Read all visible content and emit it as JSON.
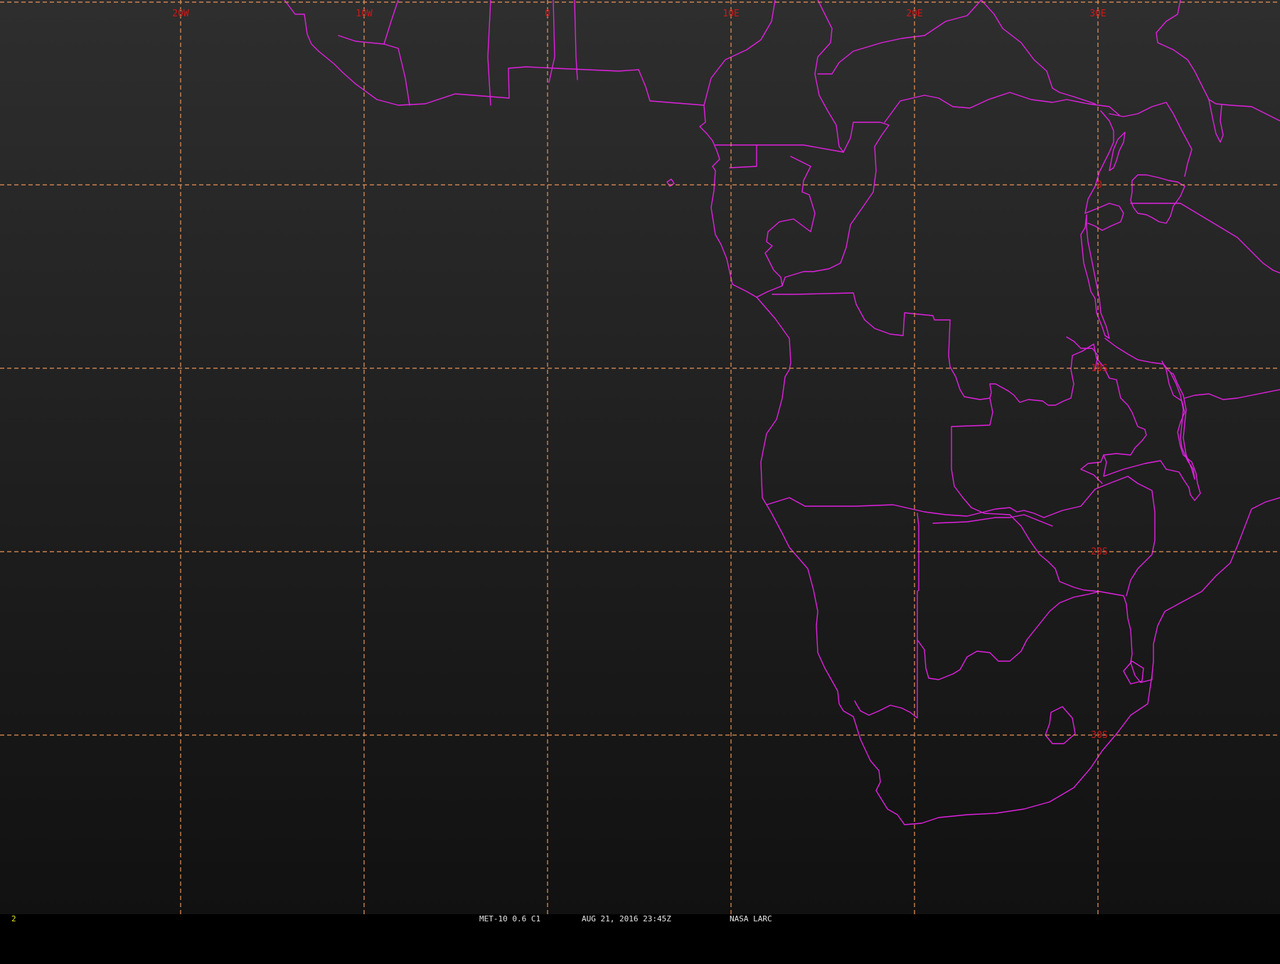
{
  "map": {
    "background_gradient": [
      "#2e2e2e",
      "#111111"
    ],
    "grid_color": "#e8935a",
    "label_color": "#d01818",
    "border_color": "#e021e0",
    "longitudes": [
      {
        "label": "20W",
        "lon": -20
      },
      {
        "label": "10W",
        "lon": -10
      },
      {
        "label": "0",
        "lon": 0
      },
      {
        "label": "10E",
        "lon": 10
      },
      {
        "label": "20E",
        "lon": 20
      },
      {
        "label": "30E",
        "lon": 30
      }
    ],
    "latitudes": [
      {
        "label": "0",
        "lat": 0
      },
      {
        "label": "10S",
        "lat": -10
      },
      {
        "label": "20S",
        "lat": -20
      },
      {
        "label": "30S",
        "lat": -30
      }
    ]
  },
  "status_bar": {
    "frame_number": "2",
    "product": "MET-10 0.6 C1",
    "datetime": "AUG 21, 2016 23:45Z",
    "source": "NASA LARC"
  }
}
